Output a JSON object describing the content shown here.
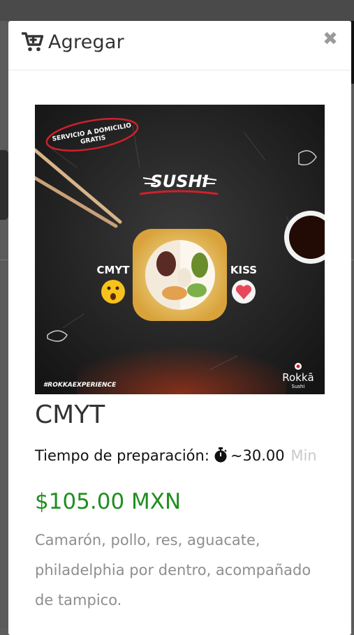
{
  "modal": {
    "title": "Agregar",
    "close_symbol": "✖",
    "cart_icon": "cart-plus-icon"
  },
  "product": {
    "image": {
      "badge_line1": "SERVICIO A DOMICILIO",
      "badge_line2": "GRATIS",
      "heading": "SUSHI",
      "left_label": "CMYT",
      "right_label": "KISS",
      "hashtag": "#ROKKAEXPERIENCE",
      "brand": "Rokkā",
      "brand_sub": "Sushi"
    },
    "name": "CMYT",
    "prep_label": "Tiempo de preparación:",
    "prep_value": "~30.00",
    "prep_unit": "Min",
    "price": "$105.00 MXN",
    "description": "Camarón, pollo, res, aguacate, philadelphia por dentro, acompañado de tampico."
  },
  "colors": {
    "price": "#1f8f1f",
    "badge_ring": "#d0202a"
  }
}
